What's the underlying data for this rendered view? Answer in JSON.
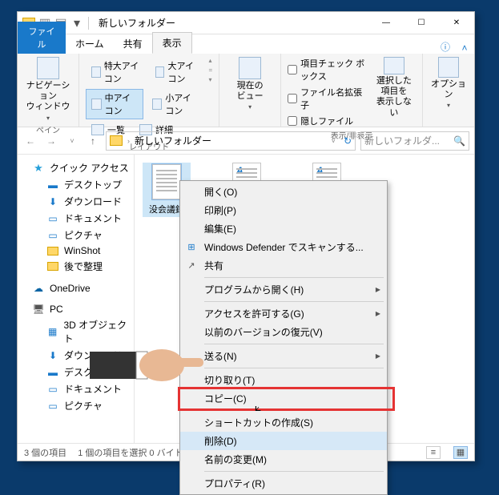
{
  "window": {
    "title": "新しいフォルダー",
    "min": "—",
    "max": "☐",
    "close": "✕"
  },
  "tabs": {
    "file": "ファイル",
    "home": "ホーム",
    "share": "共有",
    "view": "表示"
  },
  "ribbon": {
    "pane": {
      "nav": "ナビゲーション\nウィンドウ",
      "group": "ペイン"
    },
    "layout": {
      "xl": "特大アイコン",
      "lg": "大アイコン",
      "md": "中アイコン",
      "sm": "小アイコン",
      "list": "一覧",
      "detail": "詳細",
      "group": "レイアウト"
    },
    "current": {
      "label": "現在の\nビュー",
      "group": ""
    },
    "show": {
      "check": "項目チェック ボックス",
      "ext": "ファイル名拡張子",
      "hidden": "隠しファイル",
      "hidesel": "選択した項目を\n表示しない",
      "group": "表示/非表示"
    },
    "options": {
      "label": "オプション"
    }
  },
  "address": {
    "crumb1": "新しいフォルダー",
    "search_placeholder": "新しいフォルダ..."
  },
  "sidebar": {
    "quick": "クイック アクセス",
    "desktop": "デスクトップ",
    "downloads": "ダウンロード",
    "documents": "ドキュメント",
    "pictures": "ピクチャ",
    "winshot": "WinShot",
    "later": "後で整理",
    "onedrive": "OneDrive",
    "pc": "PC",
    "obj3d": "3D オブジェクト",
    "dl2": "ダウンロード",
    "desk2": "デスクトップ",
    "doc2": "ドキュメント",
    "pic2": "ピクチャ"
  },
  "files": {
    "f1": "没会議録"
  },
  "status": {
    "count": "3 個の項目",
    "sel": "1 個の項目を選択 0 バイト"
  },
  "ctx": {
    "open": "開く(O)",
    "print": "印刷(P)",
    "edit": "編集(E)",
    "defender": "Windows Defender でスキャンする...",
    "share": "共有",
    "openwith": "プログラムから開く(H)",
    "access": "アクセスを許可する(G)",
    "restore": "以前のバージョンの復元(V)",
    "sendto": "送る(N)",
    "cut": "切り取り(T)",
    "copy": "コピー(C)",
    "shortcut": "ショートカットの作成(S)",
    "delete": "削除(D)",
    "rename": "名前の変更(M)",
    "prop": "プロパティ(R)"
  }
}
